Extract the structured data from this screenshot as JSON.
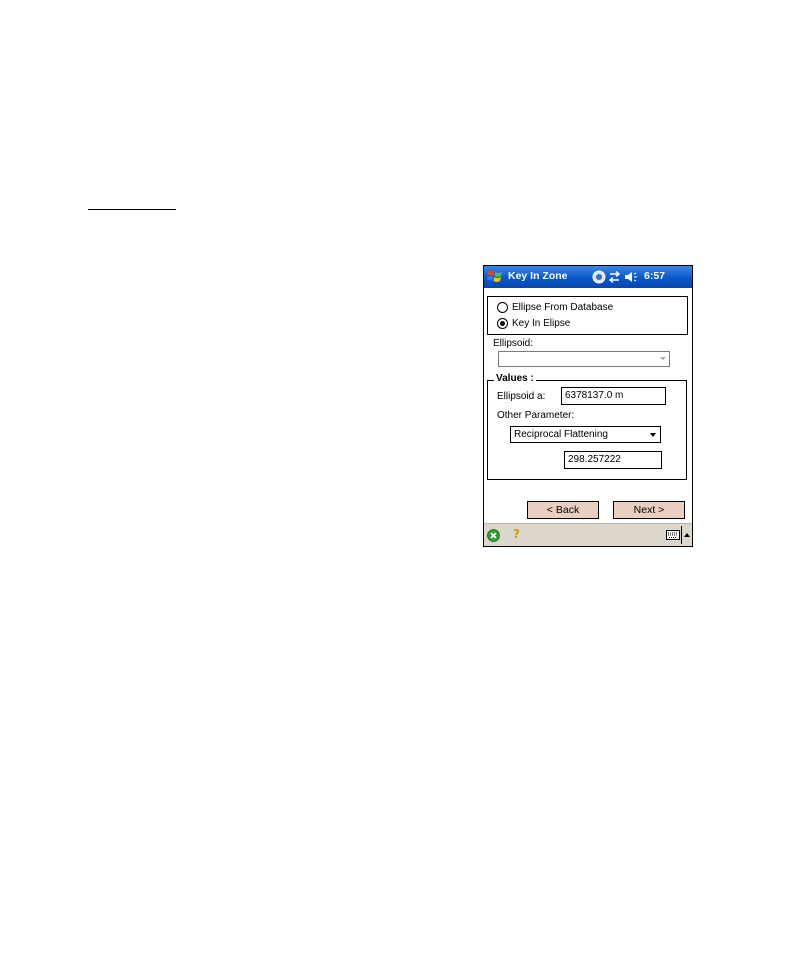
{
  "title_bar": {
    "app_title": "Key In Zone",
    "clock": "6:57",
    "icons": [
      "windows-start-icon",
      "notification-icon",
      "connectivity-icon",
      "speaker-icon"
    ]
  },
  "options": {
    "radio_database": "Ellipse From Database",
    "radio_key_in": "Key In Elipse",
    "selected": "Key In Elipse"
  },
  "ellipsoid": {
    "label": "Ellipsoid:",
    "value": ""
  },
  "values": {
    "legend": "Values :",
    "ellipsoid_a_label": "Ellipsoid a:",
    "ellipsoid_a_value": "6378137.0 m",
    "other_parameter_label": "Other Parameter:",
    "other_parameter_selected": "Reciprocal Flattening",
    "reciprocal_flattening_value": "298.257222"
  },
  "buttons": {
    "back": "< Back",
    "next": "Next >"
  },
  "bottom_bar": {
    "help": "?",
    "icons": [
      "close-icon",
      "help-icon",
      "keyboard-icon",
      "sip-arrow-icon"
    ]
  },
  "colors": {
    "title_bar": "#0a57c9",
    "button_face": "#e8cfc0",
    "bottom_bar": "#dcd6cd"
  }
}
